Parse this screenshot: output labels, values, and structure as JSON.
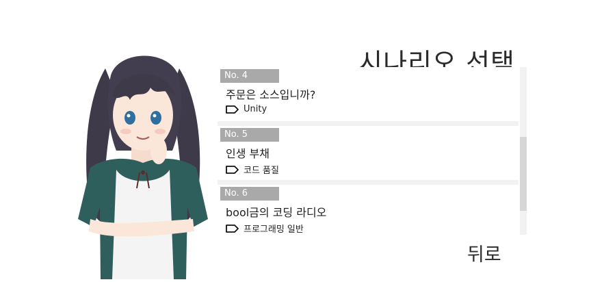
{
  "header": {
    "title": "시나리오 선택"
  },
  "scenarios": [
    {
      "no": "No. 4",
      "title": "주문은 소스입니까?",
      "tag": "Unity"
    },
    {
      "no": "No. 5",
      "title": "인생 부채",
      "tag": "코드 품질"
    },
    {
      "no": "No. 6",
      "title": "bool금의 코딩 라디오",
      "tag": "프로그래밍 일반"
    }
  ],
  "footer": {
    "back_label": "뒤로"
  },
  "icons": {
    "tag": "tag-icon"
  },
  "colors": {
    "number_badge": "#a9a9a9",
    "list_separator": "#f2f2f2",
    "hair": "#3f3a4a",
    "dress": "#2f5f5c"
  }
}
